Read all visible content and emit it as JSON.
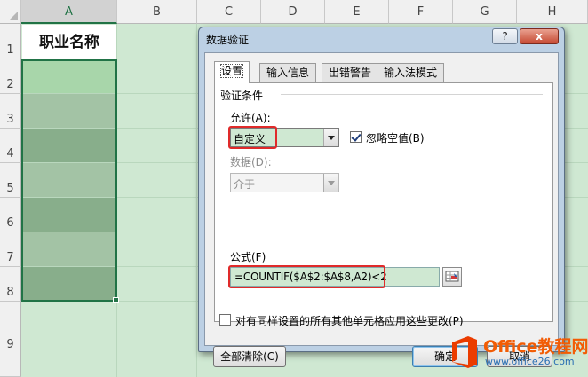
{
  "spreadsheet": {
    "columns": [
      "A",
      "B",
      "C",
      "D",
      "E",
      "F",
      "G",
      "H"
    ],
    "rows": [
      "1",
      "2",
      "3",
      "4",
      "5",
      "6",
      "7",
      "8",
      "9"
    ],
    "cells": {
      "A1": "职业名称"
    },
    "colors": {
      "sheet_bg": "#cfe8d2",
      "band_light": "#a7c9a9",
      "band_dark": "#86ad89",
      "first_band": "#a8d6aa",
      "selection_border": "#217346"
    }
  },
  "dialog": {
    "title": "数据验证",
    "help_label": "?",
    "close_label": "x",
    "tabs": [
      {
        "label": "设置",
        "active": true
      },
      {
        "label": "输入信息",
        "active": false
      },
      {
        "label": "出错警告",
        "active": false
      },
      {
        "label": "输入法模式",
        "active": false
      }
    ],
    "group_title": "验证条件",
    "allow": {
      "label": "允许(A):",
      "value": "自定义"
    },
    "ignore_blank": {
      "label": "忽略空值(B)",
      "checked": true
    },
    "data": {
      "label": "数据(D):",
      "value": "介于",
      "disabled": true
    },
    "formula": {
      "label": "公式(F)",
      "value": "=COUNTIF($A$2:$A$8,A2)<2"
    },
    "apply_all": {
      "label": "对有同样设置的所有其他单元格应用这些更改(P)",
      "checked": false
    },
    "buttons": {
      "clear_all": "全部清除(C)",
      "ok": "确定",
      "cancel": "取消"
    },
    "highlight_color": "#e02a2a"
  },
  "watermark": {
    "brand": "Office教程网",
    "url": "www.office26.com"
  }
}
